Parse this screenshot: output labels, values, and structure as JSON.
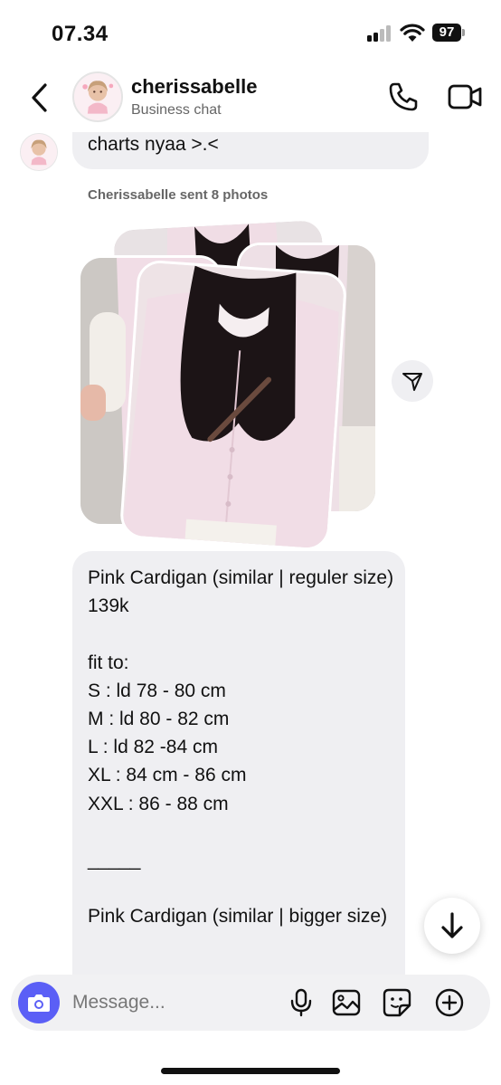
{
  "status_bar": {
    "time": "07.34",
    "battery": "97"
  },
  "header": {
    "name": "cherissabelle",
    "subtitle": "Business chat",
    "avatar_label": "Cherissabelle"
  },
  "messages": {
    "top_text": "charts nyaa >.<",
    "sent_photos": "Cherissabelle sent 8 photos",
    "product_lines": [
      "Pink Cardigan (similar | reguler size)",
      "139k",
      "",
      "fit to:",
      "S : ld 78 - 80 cm",
      "M : ld 80 - 82 cm",
      "L : ld 82 -84 cm",
      "XL : 84 cm - 86 cm",
      "XXL : 86 - 88 cm",
      "",
      "_____",
      "",
      "Pink Cardigan (similar | bigger size)"
    ]
  },
  "composer": {
    "placeholder": "Message..."
  },
  "colors": {
    "accent": "#5b5ff6",
    "bubble": "#efeff2",
    "cardigan": "#f1dde6",
    "hair": "#1c1416"
  }
}
